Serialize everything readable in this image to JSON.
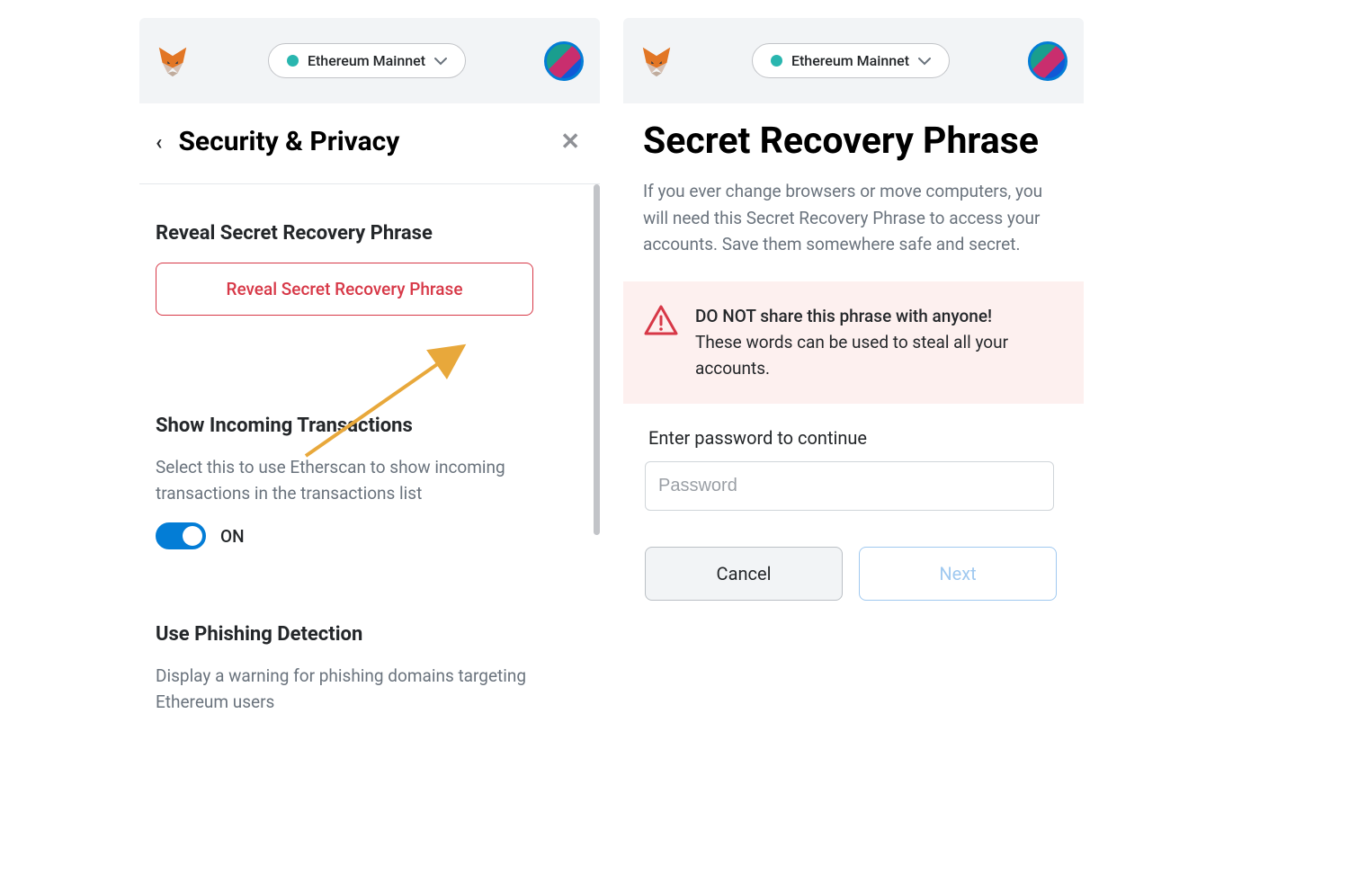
{
  "header": {
    "network_label": "Ethereum Mainnet"
  },
  "left": {
    "page_title": "Security & Privacy",
    "reveal_section_title": "Reveal Secret Recovery Phrase",
    "reveal_button_label": "Reveal Secret Recovery Phrase",
    "show_tx_title": "Show Incoming Transactions",
    "show_tx_desc": "Select this to use Etherscan to show incoming transactions in the transactions list",
    "toggle_state": "ON",
    "phishing_title": "Use Phishing Detection",
    "phishing_desc": "Display a warning for phishing domains targeting Ethereum users"
  },
  "right": {
    "page_title": "Secret Recovery Phrase",
    "description": "If you ever change browsers or move computers, you will need this Secret Recovery Phrase to access your accounts. Save them somewhere safe and secret.",
    "warning_line1": "DO NOT share this phrase with anyone!",
    "warning_line2": "These words can be used to steal all your accounts.",
    "password_label": "Enter password to continue",
    "password_placeholder": "Password",
    "cancel_label": "Cancel",
    "next_label": "Next"
  }
}
